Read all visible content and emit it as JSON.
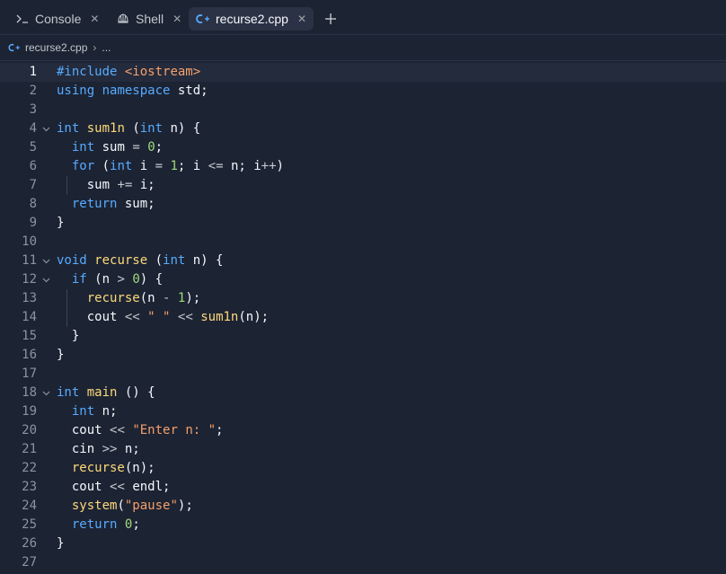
{
  "tabs": [
    {
      "label": "Console",
      "icon": "terminal-icon",
      "active": false
    },
    {
      "label": "Shell",
      "icon": "shell-icon",
      "active": false
    },
    {
      "label": "recurse2.cpp",
      "icon": "cpp-file-icon",
      "active": true
    }
  ],
  "breadcrumb": {
    "file": "recurse2.cpp",
    "more": "..."
  },
  "active_line": 1,
  "colors": {
    "background": "#1c2333",
    "keyword": "#57abff",
    "function": "#fdd97a",
    "number": "#9fdb7a",
    "string": "#f5a06a"
  },
  "code_lines": [
    {
      "n": "1",
      "text": "#include <iostream>"
    },
    {
      "n": "2",
      "text": "using namespace std;"
    },
    {
      "n": "3",
      "text": ""
    },
    {
      "n": "4",
      "text": "int sum1n (int n) {"
    },
    {
      "n": "5",
      "text": "  int sum = 0;"
    },
    {
      "n": "6",
      "text": "  for (int i = 1; i <= n; i++)"
    },
    {
      "n": "7",
      "text": "    sum += i;"
    },
    {
      "n": "8",
      "text": "  return sum;"
    },
    {
      "n": "9",
      "text": "}"
    },
    {
      "n": "10",
      "text": ""
    },
    {
      "n": "11",
      "text": "void recurse (int n) {"
    },
    {
      "n": "12",
      "text": "  if (n > 0) {"
    },
    {
      "n": "13",
      "text": "    recurse(n - 1);"
    },
    {
      "n": "14",
      "text": "    cout << \" \" << sum1n(n);"
    },
    {
      "n": "15",
      "text": "  }"
    },
    {
      "n": "16",
      "text": "}"
    },
    {
      "n": "17",
      "text": ""
    },
    {
      "n": "18",
      "text": "int main () {"
    },
    {
      "n": "19",
      "text": "  int n;"
    },
    {
      "n": "20",
      "text": "  cout << \"Enter n: \";"
    },
    {
      "n": "21",
      "text": "  cin >> n;"
    },
    {
      "n": "22",
      "text": "  recurse(n);"
    },
    {
      "n": "23",
      "text": "  cout << endl;"
    },
    {
      "n": "24",
      "text": "  system(\"pause\");"
    },
    {
      "n": "25",
      "text": "  return 0;"
    },
    {
      "n": "26",
      "text": "}"
    },
    {
      "n": "27",
      "text": ""
    }
  ]
}
